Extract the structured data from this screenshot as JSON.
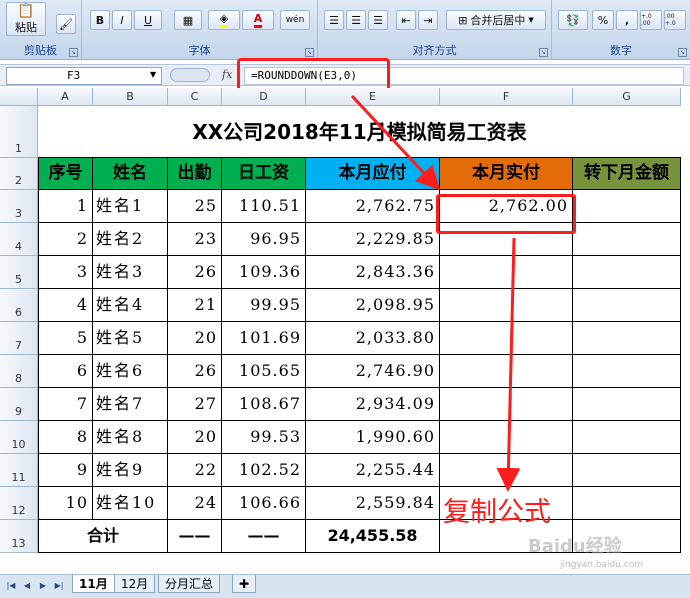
{
  "ribbon": {
    "clipboard": {
      "paste_label": "粘贴",
      "group_label": "剪贴板"
    },
    "font": {
      "group_label": "字体",
      "bold": "B",
      "italic": "I",
      "underline": "U",
      "font_color_letter": "A",
      "wen_label": "wén"
    },
    "alignment": {
      "group_label": "对齐方式",
      "merge_label": "合并后居中"
    },
    "number": {
      "group_label": "数字",
      "percent": "%",
      "comma": ",",
      "inc_decimal": "+.0 .00",
      "dec_decimal": ".00 +.0"
    }
  },
  "formula_bar": {
    "name_box": "F3",
    "fx": "fx",
    "formula": "=ROUNDDOWN(E3,0)"
  },
  "sheet": {
    "columns": [
      "A",
      "B",
      "C",
      "D",
      "E",
      "F",
      "G"
    ],
    "row_numbers": [
      "1",
      "2",
      "3",
      "4",
      "5",
      "6",
      "7",
      "8",
      "9",
      "10",
      "11",
      "12",
      "13"
    ],
    "title": "XX公司2018年11月模拟简易工资表",
    "headers": [
      "序号",
      "姓名",
      "出勤",
      "日工资",
      "本月应付",
      "本月实付",
      "转下月金额"
    ],
    "header_colors": [
      "#00b050",
      "#00b050",
      "#00b050",
      "#00b050",
      "#00b0f0",
      "#e36c09",
      "#77933c"
    ],
    "rows": [
      {
        "no": "1",
        "name": "姓名1",
        "attendance": "25",
        "daily": "110.51",
        "payable": "2,762.75",
        "paid": "2,762.00"
      },
      {
        "no": "2",
        "name": "姓名2",
        "attendance": "23",
        "daily": "96.95",
        "payable": "2,229.85",
        "paid": ""
      },
      {
        "no": "3",
        "name": "姓名3",
        "attendance": "26",
        "daily": "109.36",
        "payable": "2,843.36",
        "paid": ""
      },
      {
        "no": "4",
        "name": "姓名4",
        "attendance": "21",
        "daily": "99.95",
        "payable": "2,098.95",
        "paid": ""
      },
      {
        "no": "5",
        "name": "姓名5",
        "attendance": "20",
        "daily": "101.69",
        "payable": "2,033.80",
        "paid": ""
      },
      {
        "no": "6",
        "name": "姓名6",
        "attendance": "26",
        "daily": "105.65",
        "payable": "2,746.90",
        "paid": ""
      },
      {
        "no": "7",
        "name": "姓名7",
        "attendance": "27",
        "daily": "108.67",
        "payable": "2,934.09",
        "paid": ""
      },
      {
        "no": "8",
        "name": "姓名8",
        "attendance": "20",
        "daily": "99.53",
        "payable": "1,990.60",
        "paid": ""
      },
      {
        "no": "9",
        "name": "姓名9",
        "attendance": "22",
        "daily": "102.52",
        "payable": "2,255.44",
        "paid": ""
      },
      {
        "no": "10",
        "name": "姓名10",
        "attendance": "24",
        "daily": "106.66",
        "payable": "2,559.84",
        "paid": ""
      }
    ],
    "total": {
      "label": "合计",
      "attendance": "——",
      "daily": "——",
      "payable": "24,455.58"
    }
  },
  "annotation": {
    "text": "复制公式",
    "color": "#ff1c1c"
  },
  "watermark": {
    "text": "Baidu经验",
    "sub": "jingyan.baidu.com"
  },
  "sheet_tabs": {
    "tabs": [
      "11月",
      "12月",
      "分月汇总"
    ],
    "active": "11月"
  }
}
